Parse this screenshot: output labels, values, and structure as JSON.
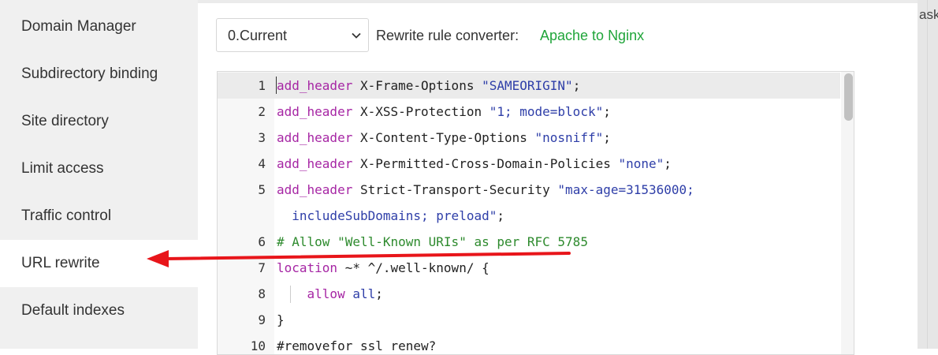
{
  "sidebar": {
    "items": [
      {
        "label": "Domain Manager"
      },
      {
        "label": "Subdirectory binding"
      },
      {
        "label": "Site directory"
      },
      {
        "label": "Limit access"
      },
      {
        "label": "Traffic control"
      },
      {
        "label": "URL rewrite",
        "active": true
      },
      {
        "label": "Default indexes"
      }
    ]
  },
  "toolbar": {
    "version_select": {
      "value": "0.Current"
    },
    "converter_label": "Rewrite rule converter:",
    "converter_link": "Apache to Nginx"
  },
  "right_edge_text": "ask",
  "editor": {
    "lines": [
      {
        "num": "1",
        "parts": [
          [
            "kw",
            "add_header"
          ],
          [
            "plain",
            " X-Frame-Options "
          ],
          [
            "str",
            "\"SAMEORIGIN\""
          ],
          [
            "plain",
            ";"
          ]
        ]
      },
      {
        "num": "2",
        "parts": [
          [
            "kw",
            "add_header"
          ],
          [
            "plain",
            " X-XSS-Protection "
          ],
          [
            "str",
            "\"1; mode=block\""
          ],
          [
            "plain",
            ";"
          ]
        ]
      },
      {
        "num": "3",
        "parts": [
          [
            "kw",
            "add_header"
          ],
          [
            "plain",
            " X-Content-Type-Options "
          ],
          [
            "str",
            "\"nosniff\""
          ],
          [
            "plain",
            ";"
          ]
        ]
      },
      {
        "num": "4",
        "parts": [
          [
            "kw",
            "add_header"
          ],
          [
            "plain",
            " X-Permitted-Cross-Domain-Policies "
          ],
          [
            "str",
            "\"none\""
          ],
          [
            "plain",
            ";"
          ]
        ]
      },
      {
        "num": "5",
        "parts": [
          [
            "kw",
            "add_header"
          ],
          [
            "plain",
            " Strict-Transport-Security "
          ],
          [
            "str",
            "\"max-age=31536000;"
          ]
        ]
      },
      {
        "num": "",
        "parts": [
          [
            "str",
            "  includeSubDomains; preload\""
          ],
          [
            "plain",
            ";"
          ]
        ]
      },
      {
        "num": "6",
        "parts": [
          [
            "cm",
            "# Allow \"Well-Known URIs\" as per RFC 5785"
          ]
        ]
      },
      {
        "num": "7",
        "parts": [
          [
            "kw",
            "location"
          ],
          [
            "plain",
            " ~* ^/.well-known/ {"
          ]
        ]
      },
      {
        "num": "8",
        "parts": [
          [
            "plain",
            "    "
          ],
          [
            "kw",
            "allow"
          ],
          [
            "plain",
            " "
          ],
          [
            "str",
            "all"
          ],
          [
            "plain",
            ";"
          ]
        ]
      },
      {
        "num": "9",
        "parts": [
          [
            "plain",
            "}"
          ]
        ]
      },
      {
        "num": "10",
        "parts": [
          [
            "plain",
            "#removefor ssl renew?"
          ]
        ]
      }
    ]
  },
  "colors": {
    "accent_green": "#20a53a",
    "annotation_red": "#e8151a",
    "sidebar_bg": "#f0f0f0",
    "keyword": "#a626a4",
    "string": "#2e3ea8",
    "comment": "#2d8a2d"
  }
}
